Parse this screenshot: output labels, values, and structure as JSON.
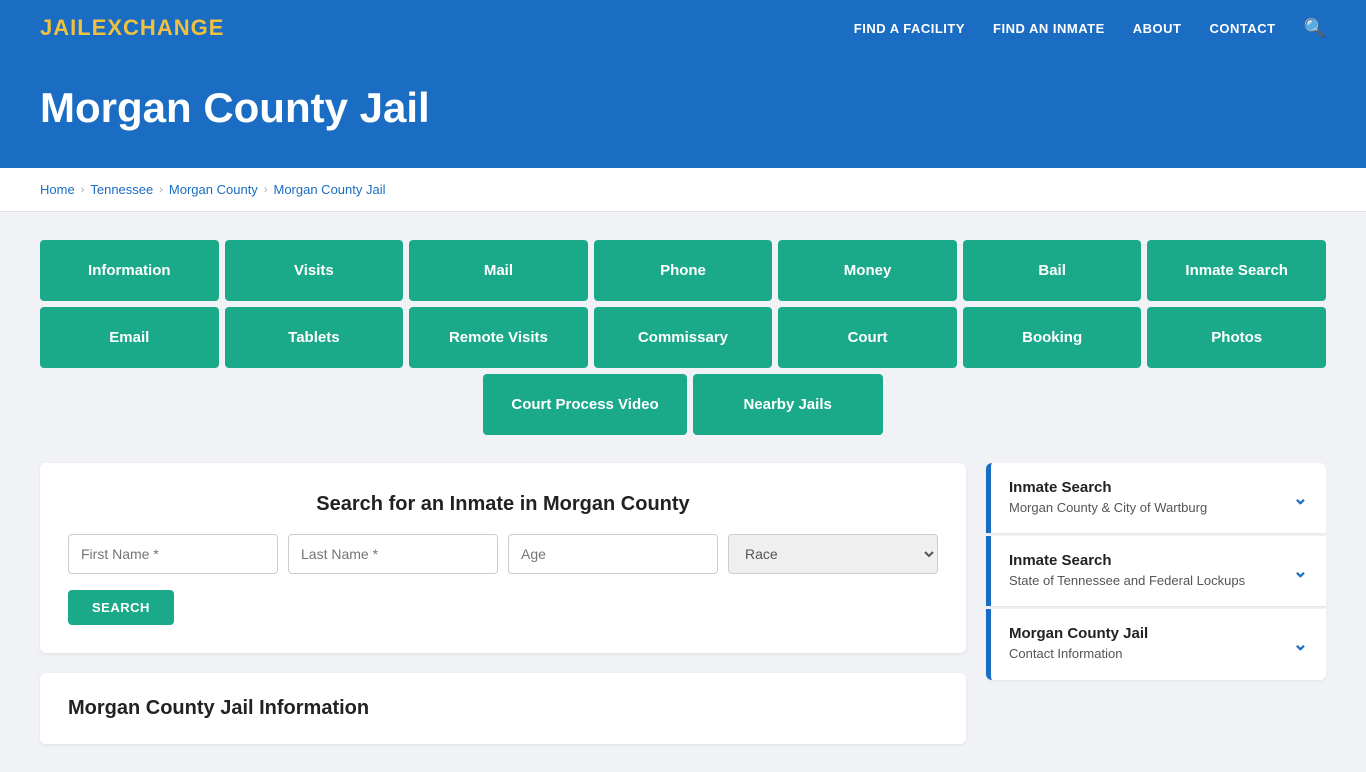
{
  "header": {
    "logo_jail": "JAIL",
    "logo_exchange": "EXCHANGE",
    "nav": [
      {
        "label": "FIND A FACILITY",
        "id": "find-facility"
      },
      {
        "label": "FIND AN INMATE",
        "id": "find-inmate"
      },
      {
        "label": "ABOUT",
        "id": "about"
      },
      {
        "label": "CONTACT",
        "id": "contact"
      }
    ]
  },
  "hero": {
    "title": "Morgan County Jail"
  },
  "breadcrumb": {
    "items": [
      {
        "label": "Home",
        "id": "bc-home"
      },
      {
        "label": "Tennessee",
        "id": "bc-state"
      },
      {
        "label": "Morgan County",
        "id": "bc-county"
      },
      {
        "label": "Morgan County Jail",
        "id": "bc-jail"
      }
    ]
  },
  "tiles_row1": [
    {
      "label": "Information",
      "id": "tile-information"
    },
    {
      "label": "Visits",
      "id": "tile-visits"
    },
    {
      "label": "Mail",
      "id": "tile-mail"
    },
    {
      "label": "Phone",
      "id": "tile-phone"
    },
    {
      "label": "Money",
      "id": "tile-money"
    },
    {
      "label": "Bail",
      "id": "tile-bail"
    },
    {
      "label": "Inmate Search",
      "id": "tile-inmate-search"
    }
  ],
  "tiles_row2": [
    {
      "label": "Email",
      "id": "tile-email"
    },
    {
      "label": "Tablets",
      "id": "tile-tablets"
    },
    {
      "label": "Remote Visits",
      "id": "tile-remote-visits"
    },
    {
      "label": "Commissary",
      "id": "tile-commissary"
    },
    {
      "label": "Court",
      "id": "tile-court"
    },
    {
      "label": "Booking",
      "id": "tile-booking"
    },
    {
      "label": "Photos",
      "id": "tile-photos"
    }
  ],
  "tiles_row3": [
    {
      "label": "Court Process Video",
      "id": "tile-court-video"
    },
    {
      "label": "Nearby Jails",
      "id": "tile-nearby-jails"
    }
  ],
  "search_section": {
    "title": "Search for an Inmate in Morgan County",
    "first_name_placeholder": "First Name *",
    "last_name_placeholder": "Last Name *",
    "age_placeholder": "Age",
    "race_placeholder": "Race",
    "search_button": "SEARCH"
  },
  "info_section": {
    "title": "Morgan County Jail Information"
  },
  "sidebar_cards": [
    {
      "title": "Inmate Search",
      "subtitle": "Morgan County & City of Wartburg",
      "id": "sidebar-inmate-search-1"
    },
    {
      "title": "Inmate Search",
      "subtitle": "State of Tennessee and Federal Lockups",
      "id": "sidebar-inmate-search-2"
    },
    {
      "title": "Morgan County Jail",
      "subtitle": "Contact Information",
      "id": "sidebar-contact-info"
    }
  ]
}
